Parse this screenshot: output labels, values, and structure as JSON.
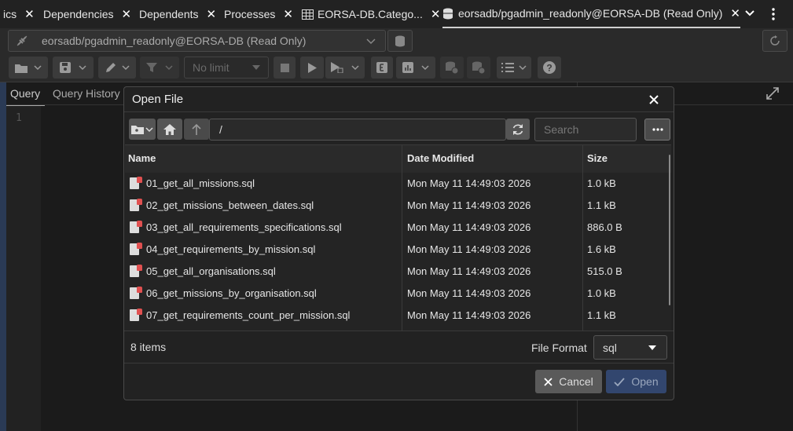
{
  "tabs": [
    {
      "label": "ics"
    },
    {
      "label": "Dependencies"
    },
    {
      "label": "Dependents"
    },
    {
      "label": "Processes"
    },
    {
      "label": "EORSA-DB.Catego..."
    },
    {
      "label": "eorsadb/pgadmin_readonly@EORSA-DB (Read Only)"
    }
  ],
  "connection": {
    "label": "eorsadb/pgadmin_readonly@EORSA-DB (Read Only)"
  },
  "toolbar": {
    "limit_label": "No limit"
  },
  "editor": {
    "tab_query": "Query",
    "tab_history": "Query History",
    "line_number": "1"
  },
  "dialog": {
    "title": "Open File",
    "path": "/",
    "search_placeholder": "Search",
    "columns": {
      "name": "Name",
      "date": "Date Modified",
      "size": "Size"
    },
    "files": [
      {
        "name": "01_get_all_missions.sql",
        "date": "Mon May 11 14:49:03 2026",
        "size": "1.0 kB"
      },
      {
        "name": "02_get_missions_between_dates.sql",
        "date": "Mon May 11 14:49:03 2026",
        "size": "1.1 kB"
      },
      {
        "name": "03_get_all_requirements_specifications.sql",
        "date": "Mon May 11 14:49:03 2026",
        "size": "886.0 B"
      },
      {
        "name": "04_get_requirements_by_mission.sql",
        "date": "Mon May 11 14:49:03 2026",
        "size": "1.6 kB"
      },
      {
        "name": "05_get_all_organisations.sql",
        "date": "Mon May 11 14:49:03 2026",
        "size": "515.0 B"
      },
      {
        "name": "06_get_missions_by_organisation.sql",
        "date": "Mon May 11 14:49:03 2026",
        "size": "1.0 kB"
      },
      {
        "name": "07_get_requirements_count_per_mission.sql",
        "date": "Mon May 11 14:49:03 2026",
        "size": "1.1 kB"
      }
    ],
    "item_count": "8 items",
    "file_format_label": "File Format",
    "file_format_value": "sql",
    "cancel_label": "Cancel",
    "open_label": "Open"
  },
  "colors": {
    "accent": "#32466e",
    "background": "#1e1e1e",
    "dialog": "#222222"
  }
}
